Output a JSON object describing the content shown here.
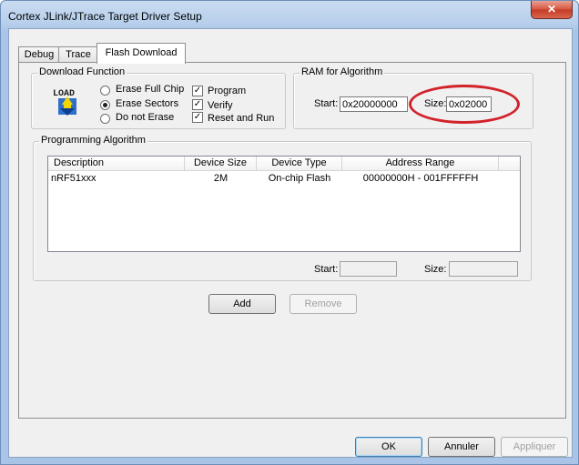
{
  "window": {
    "title": "Cortex JLink/JTrace Target Driver Setup",
    "close_glyph": "✕"
  },
  "tabs": [
    {
      "label": "Debug"
    },
    {
      "label": "Trace"
    },
    {
      "label": "Flash Download"
    }
  ],
  "download_function": {
    "group_label": "Download Function",
    "icon_text": "LOAD",
    "erase_options": [
      {
        "label": "Erase Full Chip"
      },
      {
        "label": "Erase Sectors",
        "checked": true
      },
      {
        "label": "Do not Erase"
      }
    ],
    "checks": [
      {
        "label": "Program",
        "checked": true
      },
      {
        "label": "Verify",
        "checked": true
      },
      {
        "label": "Reset and Run",
        "checked": true
      }
    ]
  },
  "ram_for_algorithm": {
    "group_label": "RAM for Algorithm",
    "start_label": "Start:",
    "start_value": "0x20000000",
    "size_label": "Size:",
    "size_value": "0x02000"
  },
  "programming_algorithm": {
    "group_label": "Programming Algorithm",
    "columns": [
      "Description",
      "Device Size",
      "Device Type",
      "Address Range"
    ],
    "rows": [
      {
        "description": "nRF51xxx",
        "device_size": "2M",
        "device_type": "On-chip Flash",
        "address_range": "00000000H - 001FFFFFH"
      }
    ],
    "start_label": "Start:",
    "start_value": "",
    "size_label": "Size:",
    "size_value": ""
  },
  "buttons": {
    "add": "Add",
    "remove": "Remove",
    "ok": "OK",
    "cancel": "Annuler",
    "apply": "Appliquer"
  },
  "colors": {
    "highlight_circle": "#d2222a",
    "title_gradient": "#b8d0ec",
    "close_button": "#c33b26"
  }
}
